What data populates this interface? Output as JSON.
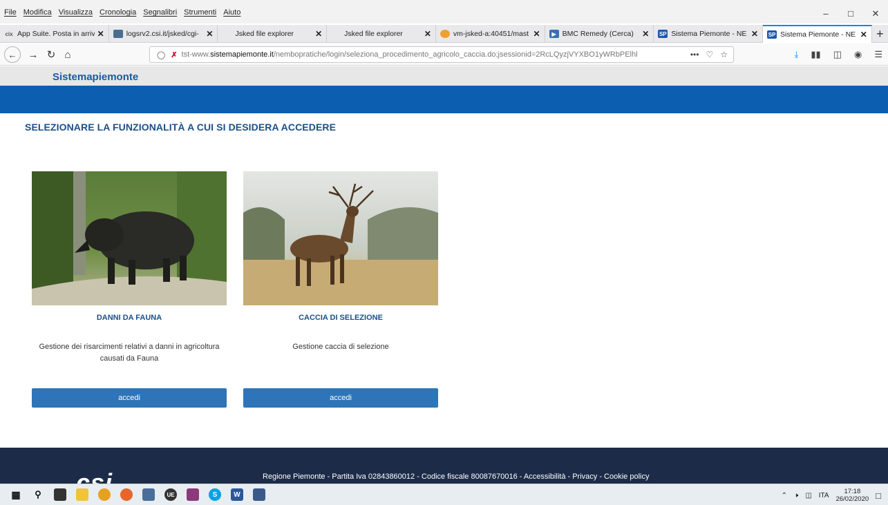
{
  "menubar": {
    "items": [
      "File",
      "Modifica",
      "Visualizza",
      "Cronologia",
      "Segnalibri",
      "Strumenti",
      "Aiuto"
    ]
  },
  "tabs": [
    {
      "label": "App Suite. Posta in arriv",
      "favicon_text": "cix",
      "favicon_color": "#6b6b6b"
    },
    {
      "label": "logsrv2.csi.it/jsked/cgi-",
      "favicon_text": "",
      "favicon_color": "#4a6e8f"
    },
    {
      "label": "Jsked file explorer",
      "favicon_text": "",
      "favicon_color": "#e9e9ec"
    },
    {
      "label": "Jsked file explorer",
      "favicon_text": "",
      "favicon_color": "#e9e9ec"
    },
    {
      "label": "vm-jsked-a:40451/mast",
      "favicon_text": "",
      "favicon_color": "#f0a030"
    },
    {
      "label": "BMC Remedy (Cerca)",
      "favicon_text": "",
      "favicon_color": "#3a6fb0"
    },
    {
      "label": "Sistema Piemonte - NE",
      "favicon_text": "SP",
      "favicon_color": "#1c5aa8"
    },
    {
      "label": "Sistema Piemonte - NE",
      "favicon_text": "SP",
      "favicon_color": "#1c5aa8"
    }
  ],
  "navbar": {
    "url_prefix": "tst-www.",
    "url_domain": "sistemapiemonte.it",
    "url_path": "/nembopratiche/login/seleziona_procedimento_agricolo_caccia.do;jsessionid=2RcLQyzjVYXBO1yWRbPElhl",
    "more_label": "•••"
  },
  "site": {
    "brand": "Sistemapiemonte",
    "heading": "SELEZIONARE LA FUNZIONALITÀ A CUI SI DESIDERA ACCEDERE"
  },
  "cards": [
    {
      "title": "DANNI DA FAUNA",
      "description": "Gestione dei risarcimenti relativi a danni in agricoltura causati da Fauna",
      "button_label": "accedi",
      "image_icon": "wild-boar-photo"
    },
    {
      "title": "CACCIA DI SELEZIONE",
      "description": "Gestione caccia di selezione",
      "button_label": "accedi",
      "image_icon": "red-deer-photo"
    }
  ],
  "footer": {
    "logo": "csi",
    "text": "Regione Piemonte - Partita Iva 02843860012 - Codice fiscale 80087670016 - Accessibilità - Privacy - Cookie policy"
  },
  "taskbar": {
    "language": "ITA",
    "time": "17:18",
    "date": "26/02/2020"
  },
  "colors": {
    "brand_blue": "#0c5eb1",
    "button_blue": "#2e74b8",
    "footer_navy": "#1c2c48",
    "heading_blue": "#1b4f88"
  }
}
